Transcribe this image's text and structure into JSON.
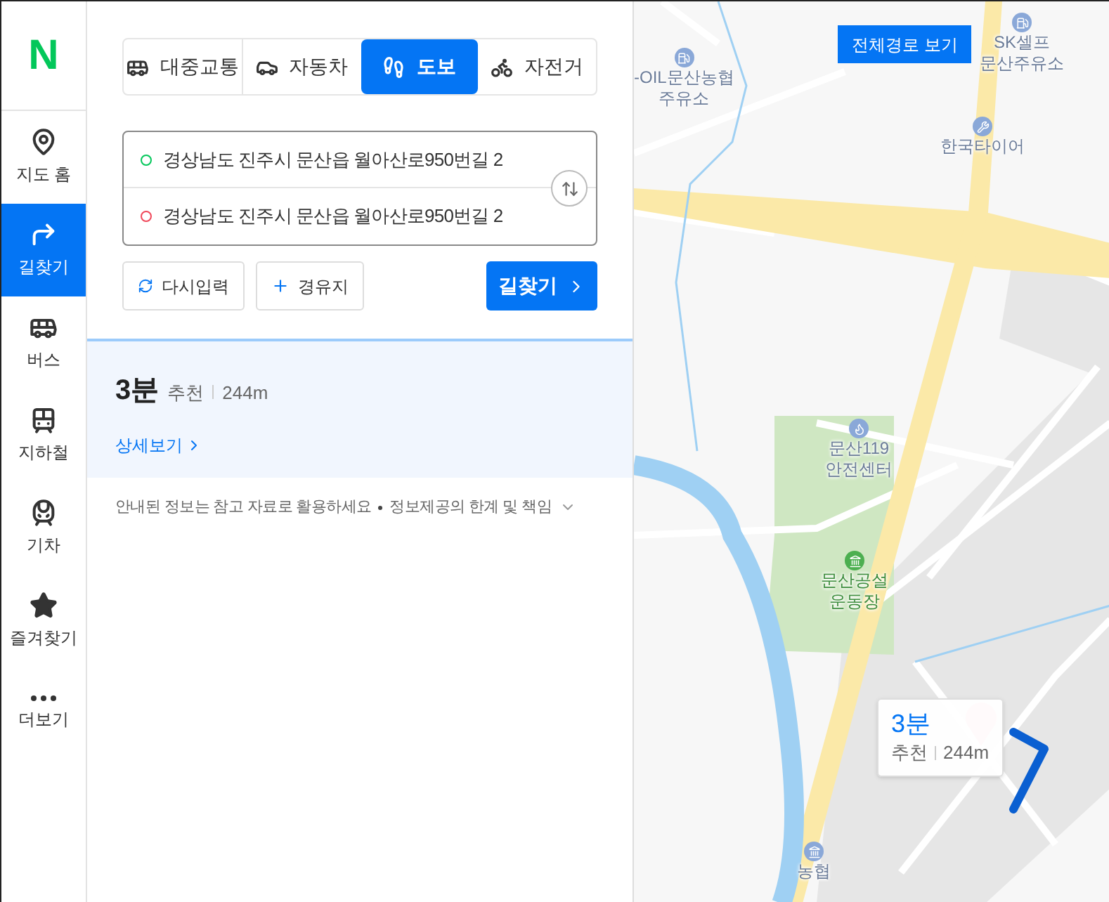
{
  "sidebar": {
    "logo": "N",
    "items": [
      {
        "kind": "home",
        "label": "지도 홈",
        "selected": false
      },
      {
        "kind": "directions",
        "label": "길찾기",
        "selected": true
      },
      {
        "kind": "bus",
        "label": "버스",
        "selected": false
      },
      {
        "kind": "subway",
        "label": "지하철",
        "selected": false
      },
      {
        "kind": "train",
        "label": "기차",
        "selected": false
      },
      {
        "kind": "star",
        "label": "즐겨찾기",
        "selected": false
      },
      {
        "kind": "more",
        "label": "더보기",
        "selected": false
      }
    ]
  },
  "mode_tabs": [
    {
      "kind": "transit",
      "label": "대중교통",
      "selected": false
    },
    {
      "kind": "car",
      "label": "자동차",
      "selected": false
    },
    {
      "kind": "walk",
      "label": "도보",
      "selected": true
    },
    {
      "kind": "bike",
      "label": "자전거",
      "selected": false
    }
  ],
  "route_inputs": [
    {
      "kind": "start",
      "value": "경상남도 진주시 문산읍 월아산로950번길 2"
    },
    {
      "kind": "end",
      "value": "경상남도 진주시 문산읍 월아산로950번길 2"
    }
  ],
  "actions": {
    "reset": "다시입력",
    "waypoint": "경유지",
    "search": "길찾기"
  },
  "result": {
    "time": "3분",
    "tag": "추천",
    "distance": "244m",
    "details": "상세보기"
  },
  "notice": {
    "text": "안내된 정보는 참고 자료로 활용하세요",
    "link": "정보제공의 한계 및 책임"
  },
  "map": {
    "full_route_button": "전체경로 보기",
    "pois": [
      {
        "kind": "fuel",
        "lines": [
          "-OIL문산농협",
          "주유소"
        ]
      },
      {
        "kind": "fuel",
        "lines": [
          "SK셀프",
          "문산주유소"
        ]
      },
      {
        "kind": "repair",
        "lines": [
          "한국타이어"
        ]
      },
      {
        "kind": "fire",
        "lines": [
          "문산119",
          "안전센터"
        ]
      },
      {
        "kind": "park",
        "lines": [
          "문산공설",
          "운동장"
        ]
      },
      {
        "kind": "bank",
        "lines": [
          "농협"
        ]
      }
    ],
    "popup": {
      "time": "3분",
      "tag": "추천",
      "distance": "244m"
    }
  }
}
